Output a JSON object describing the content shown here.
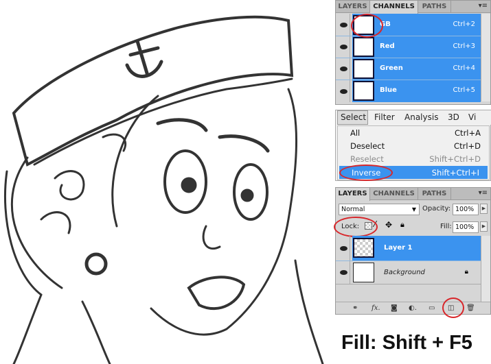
{
  "channels_panel": {
    "tabs": [
      {
        "label": "LAYERS"
      },
      {
        "label": "CHANNELS",
        "active": true
      },
      {
        "label": "PATHS"
      }
    ],
    "rows": [
      {
        "name": "RGB",
        "visible_label": "GB",
        "shortcut": "Ctrl+2"
      },
      {
        "name": "Red",
        "visible_label": "Red",
        "shortcut": "Ctrl+3"
      },
      {
        "name": "Green",
        "visible_label": "Green",
        "shortcut": "Ctrl+4"
      },
      {
        "name": "Blue",
        "visible_label": "Blue",
        "shortcut": "Ctrl+5"
      }
    ]
  },
  "select_menu": {
    "menubar": [
      "Select",
      "Filter",
      "Analysis",
      "3D",
      "Vi"
    ],
    "items": [
      {
        "label": "All",
        "shortcut": "Ctrl+A"
      },
      {
        "label": "Deselect",
        "shortcut": "Ctrl+D"
      },
      {
        "label": "Reselect",
        "shortcut": "Shift+Ctrl+D",
        "disabled": true
      },
      {
        "label": "Inverse",
        "shortcut": "Shift+Ctrl+I",
        "highlighted": true
      }
    ]
  },
  "layers_panel": {
    "tabs": [
      {
        "label": "LAYERS",
        "active": true
      },
      {
        "label": "CHANNELS"
      },
      {
        "label": "PATHS"
      }
    ],
    "blend_mode": "Normal",
    "opacity_label": "Opacity:",
    "opacity": "100%",
    "lock_label": "Lock:",
    "fill_label": "Fill:",
    "fill": "100%",
    "layers": [
      {
        "name": "Layer 1",
        "selected": true
      },
      {
        "name": "Background",
        "locked": true
      }
    ],
    "footer_icons": [
      "link-icon",
      "fx-icon",
      "mask-icon",
      "adjustment-icon",
      "folder-icon",
      "new-layer-icon",
      "trash-icon"
    ]
  },
  "caption": "Fill: Shift + F5",
  "colors": {
    "highlight": "#3b93ef",
    "annotation": "#d8262a",
    "panel": "#d6d6d6"
  }
}
